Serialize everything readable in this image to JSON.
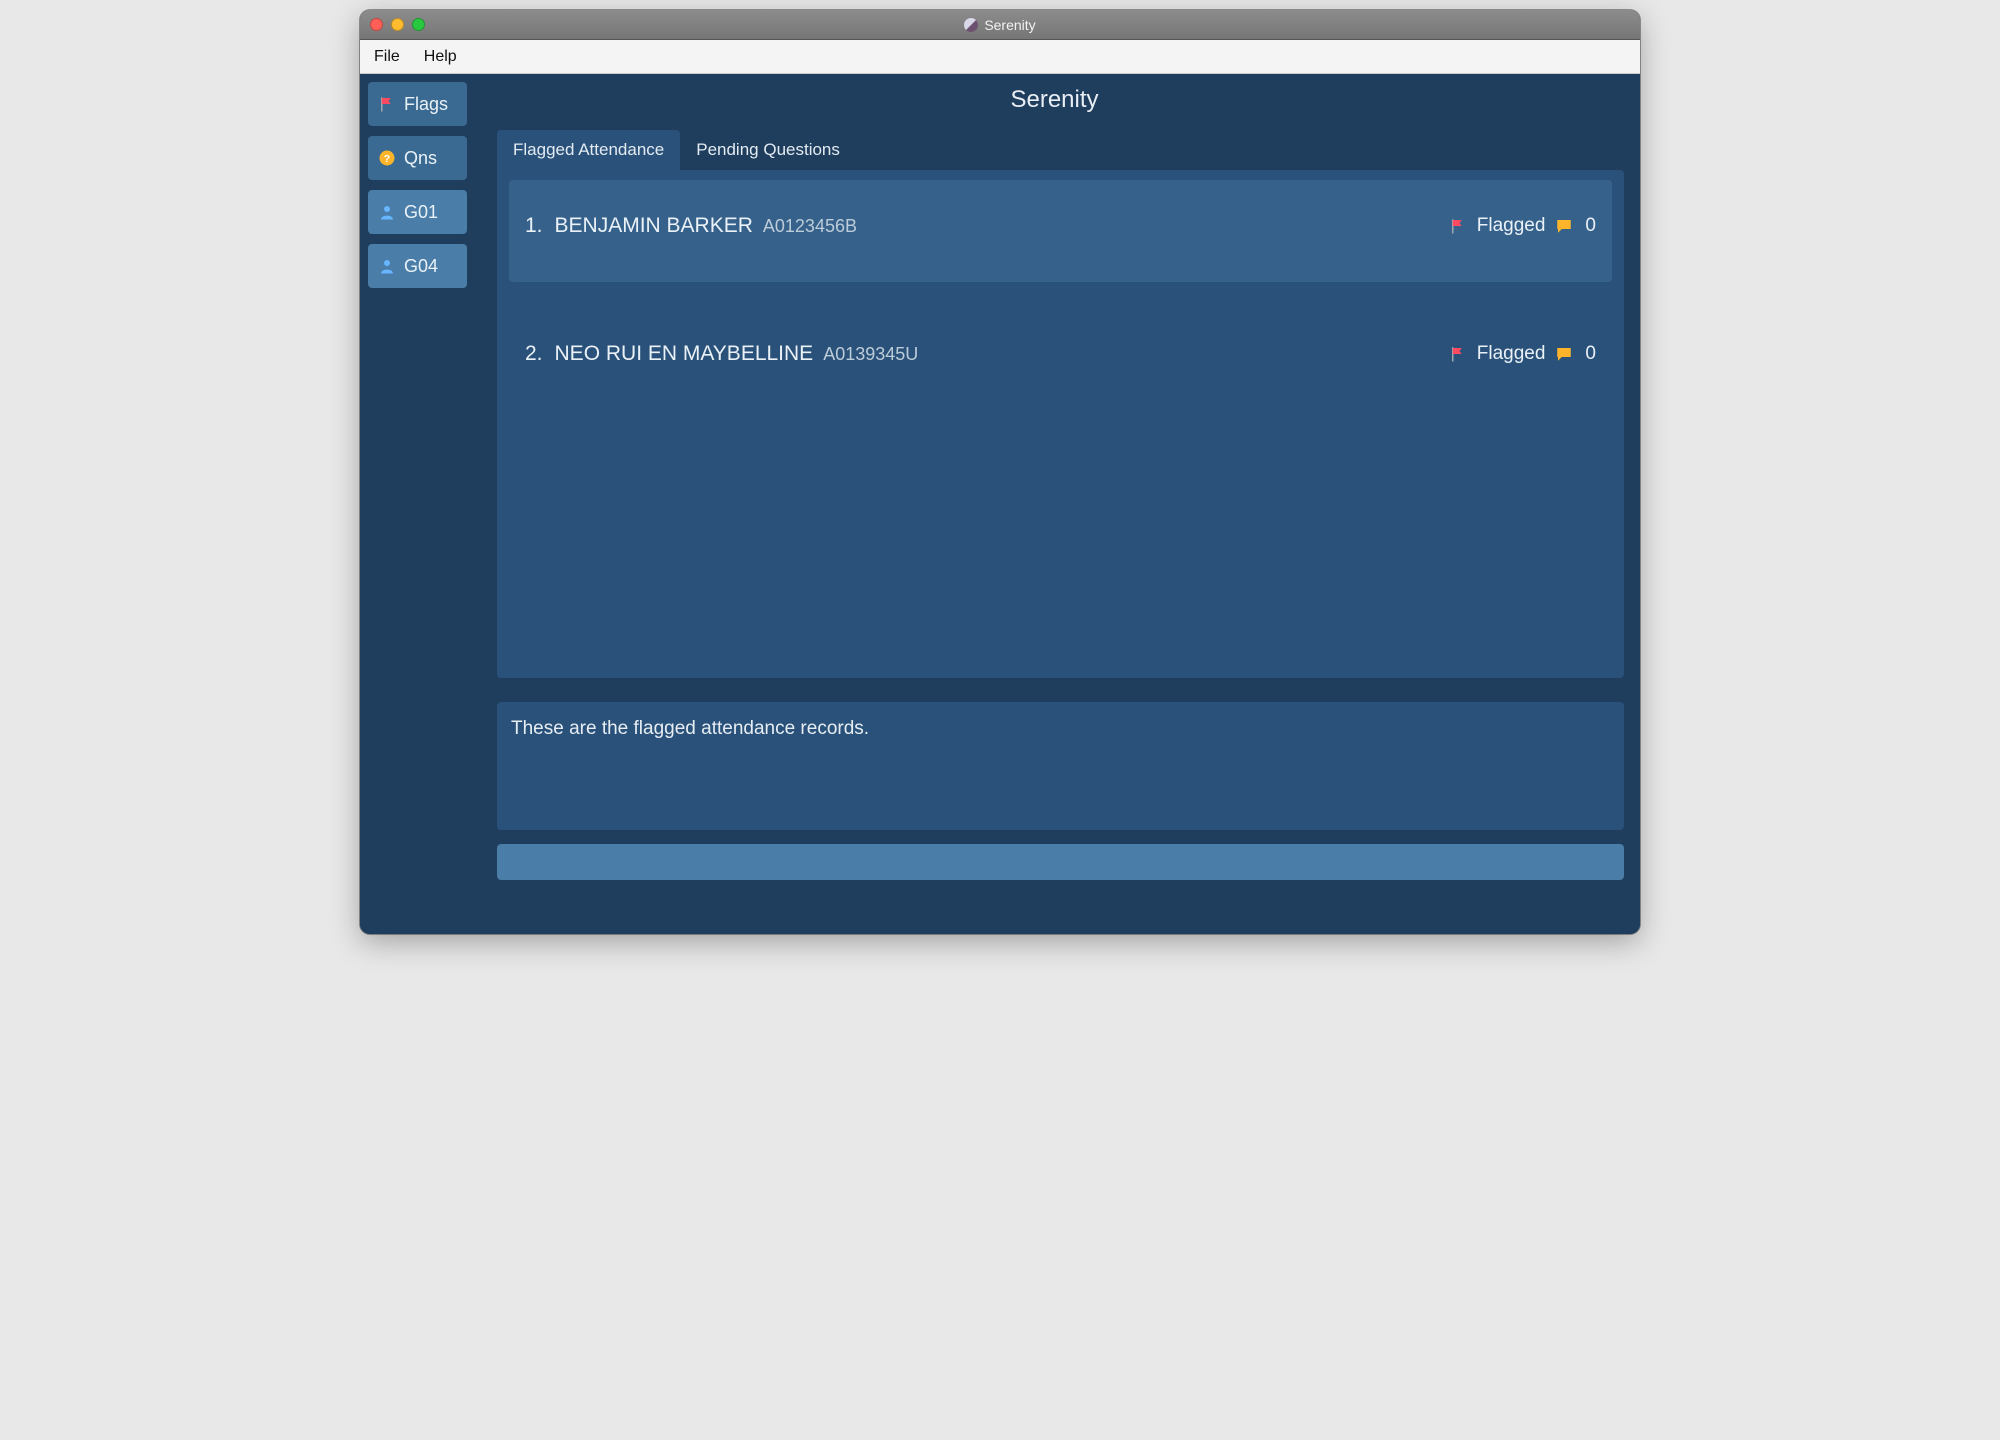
{
  "window": {
    "title": "Serenity"
  },
  "menubar": {
    "file": "File",
    "help": "Help"
  },
  "sidebar": {
    "items": [
      {
        "label": "Flags",
        "icon": "flag-icon"
      },
      {
        "label": "Qns",
        "icon": "question-icon"
      },
      {
        "label": "G01",
        "icon": "person-icon"
      },
      {
        "label": "G04",
        "icon": "person-icon"
      }
    ]
  },
  "header": {
    "title": "Serenity"
  },
  "tabs": [
    {
      "label": "Flagged Attendance",
      "active": true
    },
    {
      "label": "Pending Questions",
      "active": false
    }
  ],
  "records": [
    {
      "index": "1.",
      "name": "BENJAMIN BARKER",
      "sid": "A0123456B",
      "status": "Flagged",
      "count": "0"
    },
    {
      "index": "2.",
      "name": "NEO RUI EN MAYBELLINE",
      "sid": "A0139345U",
      "status": "Flagged",
      "count": "0"
    }
  ],
  "status_message": "These are the flagged attendance records.",
  "command_input": {
    "value": ""
  }
}
